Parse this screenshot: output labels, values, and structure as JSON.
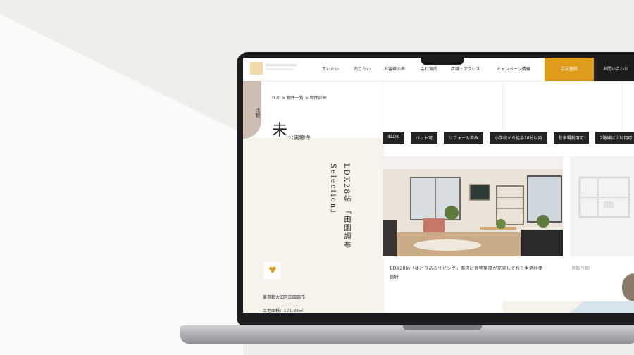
{
  "header": {
    "nav_items": [
      "買いたい",
      "売りたい",
      "お客様の声",
      "会社案内",
      "店舗・アクセス",
      "キャンペーン情報"
    ],
    "register_label": "会員登録",
    "contact_label": "お問い合わせ"
  },
  "compare_tab_label": "比較",
  "breadcrumb": "TOP > 物件一覧 > 物件詳細",
  "status": {
    "big": "未",
    "small": "公開物件"
  },
  "tags": [
    "4LDK",
    "ペット可",
    "リフォーム済み",
    "小学校から徒歩10分以内",
    "駐車場利用可",
    "2路線以上利用可"
  ],
  "vertical_title": "LDK28帖 「田園調布Selection」",
  "caption": "LDK28帖「ゆとりあるリビング」周辺に買物施設が充実しており生活利便良好",
  "floorplan_label": "見取り図",
  "address": "東京都大田区田園調布",
  "land_area": "土地面積：171.88㎡",
  "colors": {
    "accent": "#df9c1b",
    "dark": "#1e1c1b",
    "beige": "#f6f2ec",
    "tab": "#cdbdb0"
  }
}
